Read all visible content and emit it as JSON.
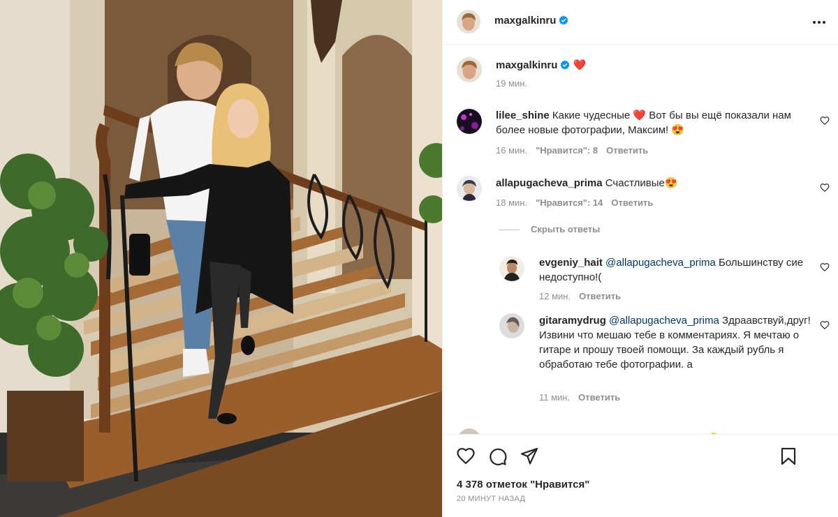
{
  "post": {
    "author": "maxgalkinru",
    "caption_emoji": "❤️",
    "caption_time": "19 мин.",
    "likes_text": "4 378 отметок \"Нравится\"",
    "posted_ago": "20 МИНУТ НАЗАД"
  },
  "labels": {
    "reply": "Ответить",
    "hide_replies": "Скрыть ответы"
  },
  "comments": [
    {
      "user": "lilee_shine",
      "text": "Какие чудесные ❤️ Вот бы вы ещё показали нам более новые фотографии, Максим! 😍",
      "time": "16 мин.",
      "likes": "\"Нравится\": 8"
    },
    {
      "user": "allapugacheva_prima",
      "text": "Счастливые😍",
      "time": "18 мин.",
      "likes": "\"Нравится\": 14"
    }
  ],
  "replies": [
    {
      "user": "evgeniy_hait",
      "mention": "@allapugacheva_prima",
      "text": "Большинству сие недоступно!(",
      "time": "12 мин."
    },
    {
      "user": "gitaramydrug",
      "mention": "@allapugacheva_prima",
      "text": "Здраавствуй,друг!Извини что мешаю тебе в комментариях. Я мечтаю о гитаре и прошу твоей помощи. За каждый рубль я обработаю тебе фотографии. а",
      "time": "11 мин."
    }
  ],
  "icons": [
    "verified-badge-icon",
    "more-options-icon",
    "heart-icon",
    "comment-icon",
    "share-icon",
    "bookmark-icon",
    "like-comment-icon"
  ],
  "colors": {
    "verified": "#0095f6",
    "mention": "#00376b",
    "muted": "#8e8e8e",
    "text": "#262626"
  }
}
